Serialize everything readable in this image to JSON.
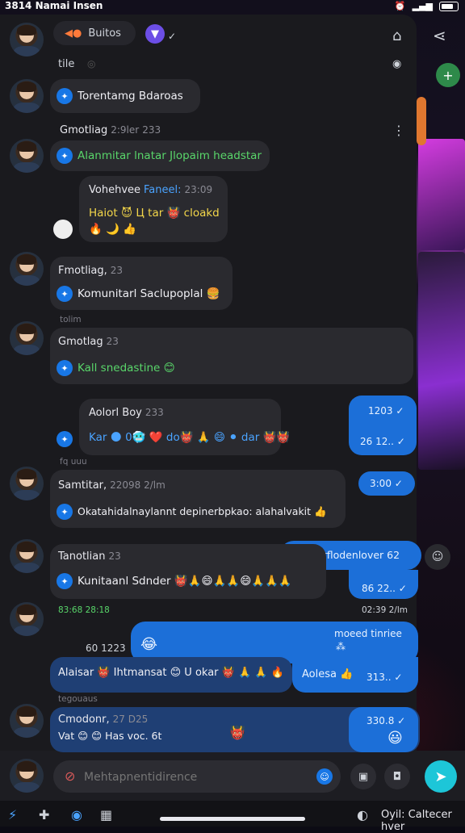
{
  "status_bar": {
    "time": "3814 Namai Insen",
    "right_icons": [
      "alarm-icon",
      "wifi-icon",
      "battery-icon"
    ]
  },
  "header": {
    "pill_label": "Buitos",
    "icons": [
      "shield-icon",
      "check-icon",
      "lock-icon",
      "share-icon"
    ]
  },
  "subheader": {
    "label": "tile"
  },
  "messages": [
    {
      "text": "Torentamg Bdaroas"
    },
    {
      "sender": "Gmotliag",
      "time": "2:9ler",
      "extra": "233",
      "text": "Alanmitar lnatar Jlopaim headstar"
    },
    {
      "sender": "Vohehvee",
      "tag": "Faneel:",
      "time": "23:09",
      "line1": "Haiot 😈 Ц tar 👹 cloakd",
      "line2": "🔥 🌙 👍"
    },
    {
      "sender": "Fmotliag,",
      "time": "23",
      "text": "Komunitarl Saclupoplal 🍔"
    },
    {
      "system": "tolim"
    },
    {
      "sender": "Gmotlag",
      "time": "23",
      "text": "Kall snedastine 😊"
    },
    {
      "sender": "Aolorl Boy",
      "time": "233",
      "text": "Kar 🌑 0🥶 ❤️ do👹 🙏 😄 ⚫ dar 👹👹",
      "out_times": [
        "1203 ✓",
        "26 12.. ✓"
      ]
    },
    {
      "system": "fq uuu"
    },
    {
      "sender": "Samtitar,",
      "time": "22098 2/lm",
      "text": "Okatahidalnaylannt depinerbpkao: alahalvakit 👍",
      "out_time": "3:00 ✓"
    },
    {
      "sender": "Tanotlian",
      "time": "23",
      "text": "Kunitaanl Sdnder 👹🙏😄🙏🙏😄🙏🙏🙏",
      "out_text": "Hilaperflodenlover 62",
      "out_time": "86 22.. ✓"
    },
    {
      "system_left": "83:68 28:18",
      "system_right": "02:39 2/lm"
    },
    {
      "out_left": "60 1223",
      "out_emoji": "😂",
      "out_top": "moeed tinriee",
      "out_sym": "⁂",
      "text": "Alaisar 👹 Ihtmansat 😊 U okar 👹 🙏 🙏 🔥",
      "bubble_text": "Aolesa 👍",
      "bubble_time": "313.. ✓"
    },
    {
      "system": "tegouaus"
    },
    {
      "sender": "Cmodonr,",
      "time": "27 D25",
      "text": "Vat 😊 😊 Has voc. 6t",
      "mid_emoji": "👹",
      "out_time": "330.8 ✓",
      "out_emoji": "😃"
    }
  ],
  "composer": {
    "placeholder": "Mehtapnentidirence"
  },
  "bottom_nav": {
    "right_label": "Oyil: Caltecer hver",
    "icons": [
      "app-icon",
      "pin-icon",
      "clock-icon",
      "grid-icon",
      "home-pill",
      "timer-icon"
    ]
  },
  "colors": {
    "panel": "#1a1a1e",
    "bubble_in": "#2a2a2f",
    "bubble_out": "#1c6fd8",
    "accent": "#1d9bf0",
    "green": "#59d66a"
  }
}
